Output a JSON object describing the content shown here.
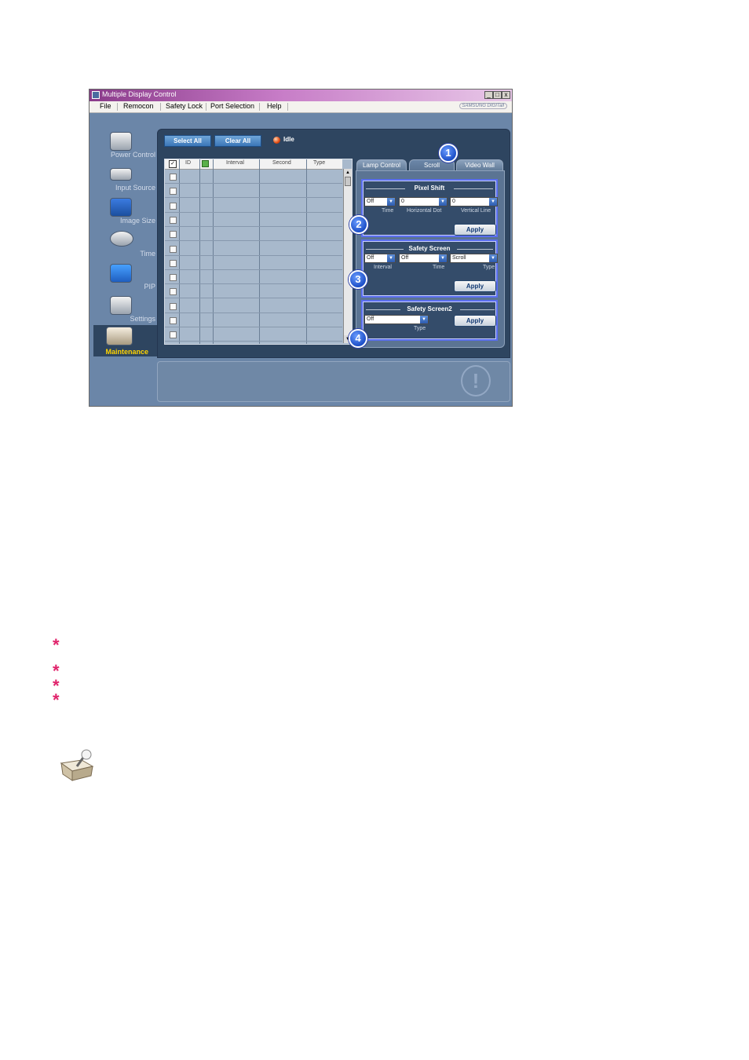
{
  "window": {
    "title": "Multiple Display Control",
    "min_btn": "_",
    "max_btn": "□",
    "close_btn": "x",
    "brand": "SAMSUNG DIGITall"
  },
  "menu": [
    "File",
    "Remocon",
    "Safety Lock",
    "Port Selection",
    "Help"
  ],
  "nav": [
    {
      "label": "Power Control",
      "icon": "power-control-icon"
    },
    {
      "label": "Input Source",
      "icon": "input-source-icon"
    },
    {
      "label": "Image Size",
      "icon": "image-size-icon"
    },
    {
      "label": "Time",
      "icon": "time-icon"
    },
    {
      "label": "PIP",
      "icon": "pip-icon"
    },
    {
      "label": "Settings",
      "icon": "settings-icon"
    },
    {
      "label": "Maintenance",
      "icon": "maintenance-icon"
    }
  ],
  "toolbar": {
    "select_all": "Select All",
    "clear_all": "Clear All",
    "status": "Idle"
  },
  "grid": {
    "columns": [
      "ID",
      "Interval",
      "Second",
      "Type"
    ],
    "row_count": 12
  },
  "tabs": [
    "Lamp Control",
    "Scroll",
    "Video Wall"
  ],
  "active_tab": "Scroll",
  "pixel_shift": {
    "title": "Pixel Shift",
    "time_value": "Off",
    "hdot_value": "0",
    "vline_value": "0",
    "time_label": "Time",
    "hdot_label": "Horizontal Dot",
    "vline_label": "Vertical Line",
    "apply": "Apply"
  },
  "safety_screen": {
    "title": "Safety Screen",
    "interval_value": "Off",
    "time_value": "Off",
    "type_value": "Scroll",
    "interval_label": "Interval",
    "time_label": "Time",
    "type_label": "Type",
    "apply": "Apply"
  },
  "safety_screen2": {
    "title": "Safety Screen2",
    "type_value": "Off",
    "type_label": "Type",
    "apply": "Apply"
  },
  "markers": [
    "1",
    "2",
    "3",
    "4"
  ],
  "footnotes": [
    "*",
    "*",
    "*",
    "*"
  ],
  "colors": {
    "accent": "#5a6ef0",
    "marker": "#1d4fc8",
    "star": "#e0236b",
    "idle_dot": "#e24a10"
  }
}
